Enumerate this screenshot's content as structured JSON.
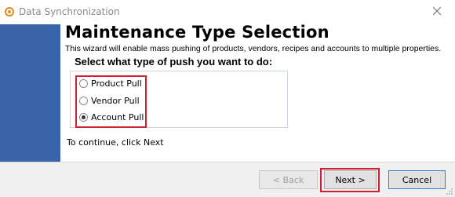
{
  "window": {
    "title": "Data Synchronization"
  },
  "content": {
    "heading": "Maintenance Type Selection",
    "subtitle": "This wizard will enable mass pushing of products, vendors, recipes and accounts to multiple properties.",
    "prompt": "Select what type of push you want to do:",
    "options": [
      {
        "label": "Product Pull",
        "checked": false
      },
      {
        "label": "Vendor Pull",
        "checked": false
      },
      {
        "label": "Account Pull",
        "checked": true
      }
    ],
    "continue_text": "To continue, click Next"
  },
  "footer": {
    "back_label": "< Back",
    "next_label": "Next >",
    "cancel_label": "Cancel"
  },
  "colors": {
    "banner": "#3a64a9",
    "highlight": "#d0202f",
    "focus_border": "#2f7bd6"
  }
}
